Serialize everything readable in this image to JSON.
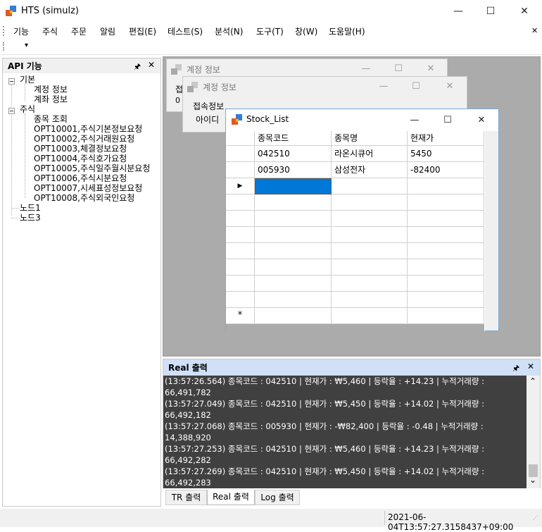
{
  "window": {
    "title": "HTS (simulz)",
    "minimize": "—",
    "maximize": "☐",
    "close": "✕"
  },
  "menu": {
    "items": [
      "기능",
      "주식",
      "주문",
      "알림",
      "편집(E)",
      "테스트(S)",
      "분석(N)",
      "도구(T)",
      "창(W)",
      "도움말(H)"
    ],
    "close_glyph": "✕",
    "toolbar_dropdown_glyph": "▾"
  },
  "left_panel": {
    "title": "API 기능",
    "pin_glyph": "🖈",
    "close_glyph": "✕",
    "tree": {
      "basic": "기본",
      "basic_children": [
        "계정 정보",
        "계좌 정보"
      ],
      "stock": "주식",
      "stock_children": [
        "종목 조회",
        "OPT10001,주식기본정보요청",
        "OPT10002,주식거래원요청",
        "OPT10003,체결정보요청",
        "OPT10004,주식호가요청",
        "OPT10005,주식일주월시분요청",
        "OPT10006,주식시분요청",
        "OPT10007,시세표성정보요청",
        "OPT10008,주식외국인요청"
      ],
      "node1": "노드1",
      "node3": "노드3"
    }
  },
  "mdi": {
    "account_win1": {
      "title": "계정 정보",
      "partial_label": "접",
      "partial_value": "0"
    },
    "account_win2": {
      "title": "계정 정보",
      "group_label": "접속정보",
      "id_label": "아이디"
    },
    "stock_list": {
      "title": "Stock_List",
      "columns": [
        "종목코드",
        "종목명",
        "현재가"
      ],
      "rows": [
        [
          "042510",
          "라온시큐어",
          "5450"
        ],
        [
          "005930",
          "삼성전자",
          "-82400"
        ]
      ],
      "current_row_glyph": "▶",
      "new_row_glyph": "*"
    }
  },
  "real_panel": {
    "title": "Real 출력",
    "pin_glyph": "🖈",
    "close_glyph": "✕",
    "lines": [
      "(13:57:26.564) 종목코드 : 042510 | 현재가 : ₩5,460 | 등락율 : +14.23 | 누적거래량 :",
      "66,491,782",
      "(13:57:27.049) 종목코드 : 042510 | 현재가 : ₩5,450 | 등락율 : +14.02 | 누적거래량 :",
      "66,492,182",
      "(13:57:27.068) 종목코드 : 005930 | 현재가 : -₩82,400 | 등락율 : -0.48 | 누적거래량 :",
      "14,388,920",
      "(13:57:27.253) 종목코드 : 042510 | 현재가 : ₩5,460 | 등락율 : +14.23 | 누적거래량 :",
      "66,492,282",
      "(13:57:27.269) 종목코드 : 042510 | 현재가 : ₩5,450 | 등락율 : +14.02 | 누적거래량 :",
      "66,492,283"
    ],
    "scroll_up": "⌃",
    "scroll_down": "⌄"
  },
  "bottom_tabs": [
    "TR 출력",
    "Real 출력",
    "Log 출력"
  ],
  "status": {
    "timestamp": "2021-06-04T13:57:27.3158437+09:00"
  }
}
